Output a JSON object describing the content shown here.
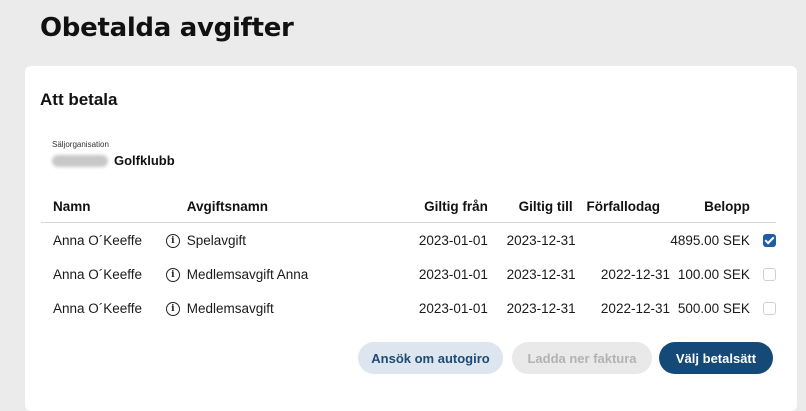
{
  "page": {
    "title": "Obetalda avgifter"
  },
  "section": {
    "title": "Att betala"
  },
  "seller": {
    "label": "Säljorganisation",
    "name": "Golfklubb"
  },
  "table": {
    "headers": {
      "name": "Namn",
      "fee": "Avgiftsnamn",
      "valid_from": "Giltig från",
      "valid_to": "Giltig till",
      "due": "Förfallodag",
      "amount": "Belopp"
    },
    "rows": [
      {
        "name": "Anna O´Keeffe",
        "fee": "Spelavgift",
        "valid_from": "2023-01-01",
        "valid_to": "2023-12-31",
        "due": "",
        "amount": "4895.00 SEK",
        "checked": true
      },
      {
        "name": "Anna O´Keeffe",
        "fee": "Medlemsavgift Anna",
        "valid_from": "2023-01-01",
        "valid_to": "2023-12-31",
        "due": "2022-12-31",
        "amount": "100.00 SEK",
        "checked": false
      },
      {
        "name": "Anna O´Keeffe",
        "fee": "Medlemsavgift",
        "valid_from": "2023-01-01",
        "valid_to": "2023-12-31",
        "due": "2022-12-31",
        "amount": "500.00 SEK",
        "checked": false
      }
    ]
  },
  "buttons": {
    "autogiro": "Ansök om autogiro",
    "invoice": "Ladda ner faktura",
    "pay": "Välj betalsätt"
  },
  "colors": {
    "primary": "#154a78",
    "checkbox": "#1f5da6",
    "background": "#ebebeb"
  },
  "icons": {
    "info": "info-circle-icon"
  }
}
